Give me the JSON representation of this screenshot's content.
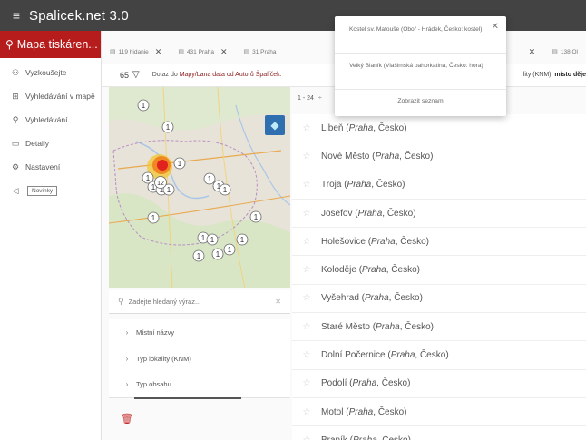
{
  "app": {
    "title": "Spalicek.net 3.0"
  },
  "sidebar": {
    "brand": "Mapa tiskáren...",
    "items": [
      {
        "label": "Vyzkoušejte",
        "icon": "hierarchy-icon"
      },
      {
        "label": "Vyhledávání v mapě",
        "icon": "map-search-icon"
      },
      {
        "label": "Vyhledávání",
        "icon": "search-icon"
      },
      {
        "label": "Detaily",
        "icon": "folder-icon"
      },
      {
        "label": "Nastavení",
        "icon": "gear-icon"
      },
      {
        "label": "Novinky",
        "icon": "megaphone-icon"
      }
    ]
  },
  "tabs": [
    {
      "label": "119 hidanie"
    },
    {
      "label": "431 Praha"
    },
    {
      "label": "31 Praha"
    },
    {
      "label": ""
    },
    {
      "label": ""
    },
    {
      "label": "138 Ol"
    }
  ],
  "query": {
    "count": "65",
    "prefix": "Dotaz do ",
    "link": "Mapy/Lana data od Autorů Špalíček:",
    "right_prefix": "lity (KNM): ",
    "right_bold": "místo děje"
  },
  "popup": {
    "items": [
      "Kostel sv. Matouše (Oboř - Hrádek, Česko: kostel)",
      "Velký Blaník (Vlašimská pahorkatina, Česko: hora)"
    ],
    "button": "Zobrazit seznam"
  },
  "search": {
    "placeholder": "Zadejte hledaný výraz..."
  },
  "filters": [
    "Místní názvy",
    "Typ lokality (KNM)",
    "Typ obsahu"
  ],
  "pager": {
    "range": "1 - 24"
  },
  "results": [
    {
      "place": "Libeň",
      "city": "Praha",
      "country": "Česko"
    },
    {
      "place": "Nové Město",
      "city": "Praha",
      "country": "Česko"
    },
    {
      "place": "Troja",
      "city": "Praha",
      "country": "Česko"
    },
    {
      "place": "Josefov",
      "city": "Praha",
      "country": "Česko"
    },
    {
      "place": "Holešovice",
      "city": "Praha",
      "country": "Česko"
    },
    {
      "place": "Koloděje",
      "city": "Praha",
      "country": "Česko"
    },
    {
      "place": "Vyšehrad",
      "city": "Praha",
      "country": "Česko"
    },
    {
      "place": "Staré Město",
      "city": "Praha",
      "country": "Česko"
    },
    {
      "place": "Dolní Počernice",
      "city": "Praha",
      "country": "Česko"
    },
    {
      "place": "Podolí",
      "city": "Praha",
      "country": "Česko"
    },
    {
      "place": "Motol",
      "city": "Praha",
      "country": "Česko"
    },
    {
      "place": "Braník",
      "city": "Praha",
      "country": "Česko"
    }
  ],
  "map": {
    "markers": [
      {
        "label": "1"
      },
      {
        "label": "1"
      },
      {
        "label": "1"
      },
      {
        "label": "1"
      },
      {
        "label": "1"
      },
      {
        "label": "1"
      },
      {
        "label": "1"
      },
      {
        "label": "1"
      },
      {
        "label": "1"
      },
      {
        "label": "1"
      },
      {
        "label": "1"
      },
      {
        "label": "1"
      },
      {
        "label": "1"
      },
      {
        "label": "1"
      },
      {
        "label": "1"
      },
      {
        "label": "1"
      },
      {
        "label": "1"
      },
      {
        "label": "1"
      },
      {
        "label": "12"
      }
    ]
  },
  "colors": {
    "brand": "#b71c1c",
    "topbar": "#434343",
    "accent_link": "#8b1a1a",
    "layers_button": "#2f6fb0"
  }
}
